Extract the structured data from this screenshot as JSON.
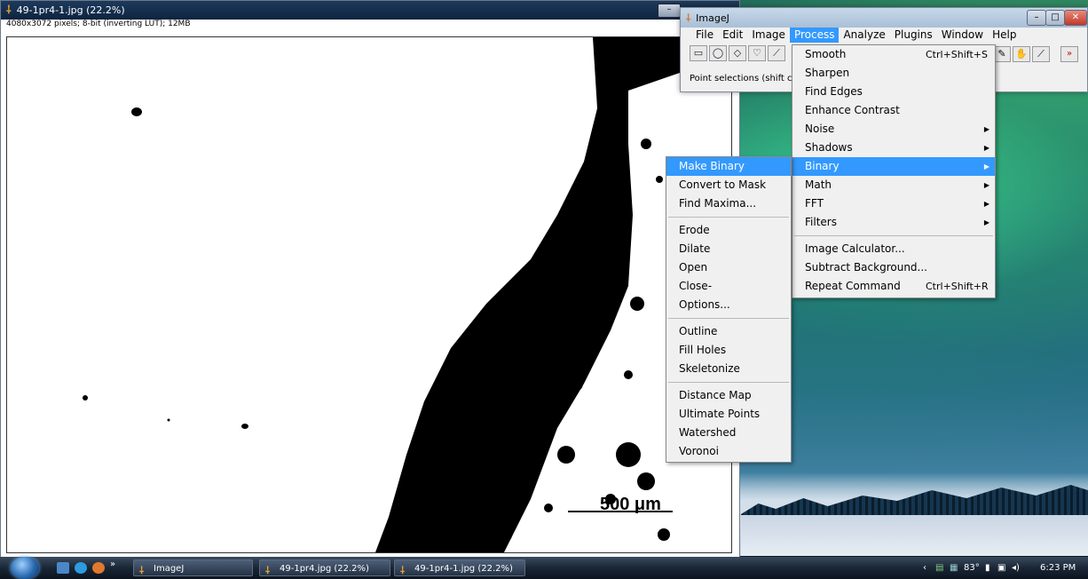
{
  "image_window": {
    "title": "49-1pr4-1.jpg (22.2%)",
    "info": "4080x3072 pixels; 8-bit (inverting LUT); 12MB",
    "minimize": "–",
    "scale_label": "500 μm"
  },
  "imagej": {
    "title": "ImageJ",
    "menus": [
      "File",
      "Edit",
      "Image",
      "Process",
      "Analyze",
      "Plugins",
      "Window",
      "Help"
    ],
    "active_menu": "Process",
    "status": "Point selections (shift c"
  },
  "process_menu": [
    {
      "label": "Smooth",
      "shortcut": "Ctrl+Shift+S"
    },
    {
      "label": "Sharpen"
    },
    {
      "label": "Find Edges"
    },
    {
      "label": "Enhance Contrast"
    },
    {
      "label": "Noise",
      "submenu": true
    },
    {
      "label": "Shadows",
      "submenu": true
    },
    {
      "label": "Binary",
      "submenu": true,
      "selected": true
    },
    {
      "label": "Math",
      "submenu": true
    },
    {
      "label": "FFT",
      "submenu": true
    },
    {
      "label": "Filters",
      "submenu": true
    },
    {
      "label": "Image Calculator..."
    },
    {
      "label": "Subtract Background..."
    },
    {
      "label": "Repeat Command",
      "shortcut": "Ctrl+Shift+R"
    }
  ],
  "binary_menu": [
    "Make Binary",
    "Convert to Mask",
    "Find Maxima...",
    "Erode",
    "Dilate",
    "Open",
    "Close-",
    "Options...",
    "Outline",
    "Fill Holes",
    "Skeletonize",
    "Distance Map",
    "Ultimate Points",
    "Watershed",
    "Voronoi"
  ],
  "taskbar": {
    "items": [
      "ImageJ",
      "49-1pr4.jpg (22.2%)",
      "49-1pr4-1.jpg (22.2%)"
    ],
    "temperature": "83°",
    "clock": "6:23 PM"
  }
}
